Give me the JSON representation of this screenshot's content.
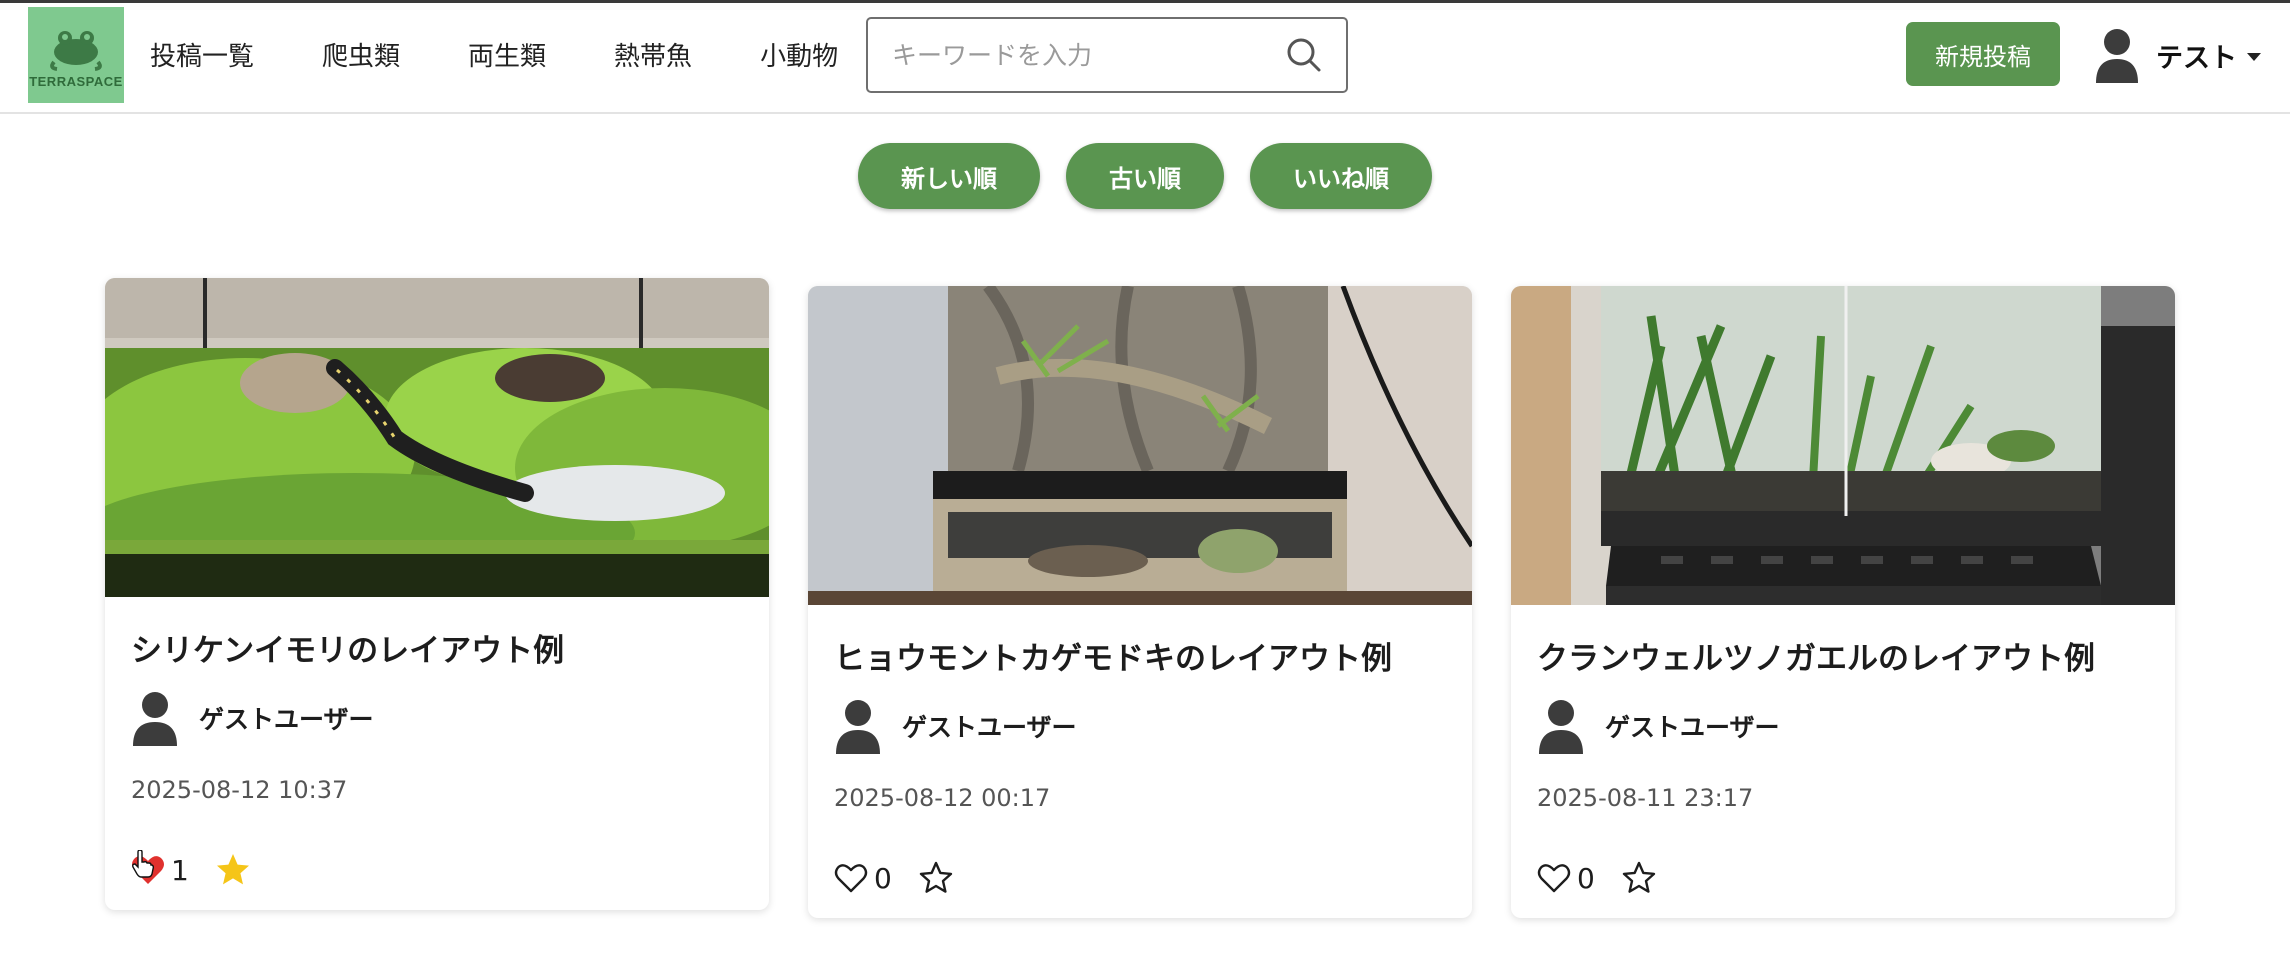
{
  "brand": {
    "logo_text": "TERRASPACE"
  },
  "nav": {
    "links": [
      "投稿一覧",
      "爬虫類",
      "両生類",
      "熱帯魚",
      "小動物"
    ]
  },
  "search": {
    "placeholder": "キーワードを入力",
    "value": ""
  },
  "header": {
    "new_post_label": "新規投稿",
    "user_name": "テスト"
  },
  "sort": {
    "buttons": [
      "新しい順",
      "古い順",
      "いいね順"
    ]
  },
  "colors": {
    "accent": "#5a9550",
    "liked_heart": "#e0312e",
    "favorited_star": "#f5c518",
    "logo_bg": "#7fc98f"
  },
  "posts": [
    {
      "title": "シリケンイモリのレイアウト例",
      "author": "ゲストユーザー",
      "date": "2025-08-12 10:37",
      "likes": "1",
      "liked": true,
      "favorited": true,
      "image_icon": "moss-terrarium-newt-photo"
    },
    {
      "title": "ヒョウモントカゲモドキのレイアウト例",
      "author": "ゲストユーザー",
      "date": "2025-08-12 00:17",
      "likes": "0",
      "liked": false,
      "favorited": false,
      "image_icon": "rock-wall-gecko-terrarium-photo"
    },
    {
      "title": "クランウェルツノガエルのレイアウト例",
      "author": "ゲストユーザー",
      "date": "2025-08-11 23:17",
      "likes": "0",
      "liked": false,
      "favorited": false,
      "image_icon": "planted-glass-frog-terrarium-photo"
    }
  ]
}
